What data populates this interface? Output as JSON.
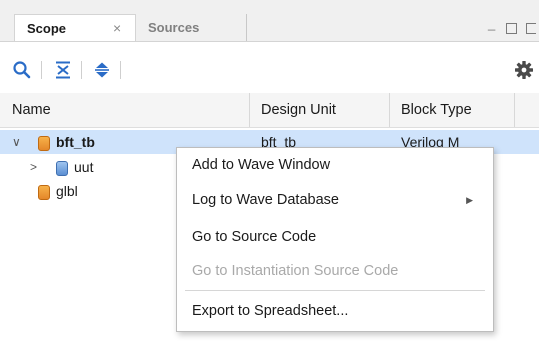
{
  "tabs": {
    "scope_label": "Scope",
    "sources_label": "Sources",
    "close_glyph": "×"
  },
  "window": {
    "minimize_glyph": "_"
  },
  "toolbar": {
    "icons": [
      "search-icon",
      "collapse-all-icon",
      "expand-all-icon",
      "gear-icon"
    ]
  },
  "table": {
    "columns": [
      "Name",
      "Design Unit",
      "Block Type"
    ],
    "rows": [
      {
        "name": "bft_tb",
        "design_unit": "bft_tb",
        "block_type": "Verilog M"
      },
      {
        "name": "uut",
        "design_unit": "",
        "block_type": ""
      },
      {
        "name": "glbl",
        "design_unit": "",
        "block_type": ""
      }
    ]
  },
  "context_menu": {
    "items": [
      {
        "label": "Add to Wave Window",
        "enabled": true
      },
      {
        "label": "Log to Wave Database",
        "enabled": true,
        "submenu": true
      },
      {
        "label": "Go to Source Code",
        "enabled": true
      },
      {
        "label": "Go to Instantiation Source Code",
        "enabled": false
      },
      {
        "label": "Export to Spreadsheet...",
        "enabled": true
      }
    ]
  },
  "colors": {
    "selection": "#cfe3fb",
    "accent_blue": "#2a6cc7",
    "module_orange": "#e4872a"
  }
}
